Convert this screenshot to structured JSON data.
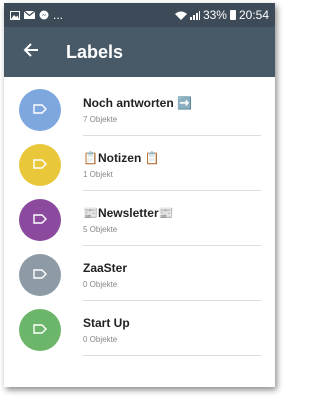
{
  "status_bar": {
    "battery": "33%",
    "time": "20:54",
    "more": "..."
  },
  "app_bar": {
    "title": "Labels",
    "back_icon": "arrow-left-icon"
  },
  "labels": [
    {
      "name": "Noch antworten ➡️",
      "count": "7 Objekte",
      "color": "#7ea7e0"
    },
    {
      "name": "📋Notizen 📋",
      "count": "1 Objekt",
      "color": "#e8c73a"
    },
    {
      "name": "📰Newsletter📰",
      "count": "5 Objekte",
      "color": "#8b4a9e"
    },
    {
      "name": "ZaaSter",
      "count": "0 Objekte",
      "color": "#8e9ba6"
    },
    {
      "name": "Start Up",
      "count": "0 Objekte",
      "color": "#6bb66a"
    }
  ],
  "colors": {
    "status_bar": "#3d4b58",
    "app_bar": "#485a68"
  }
}
